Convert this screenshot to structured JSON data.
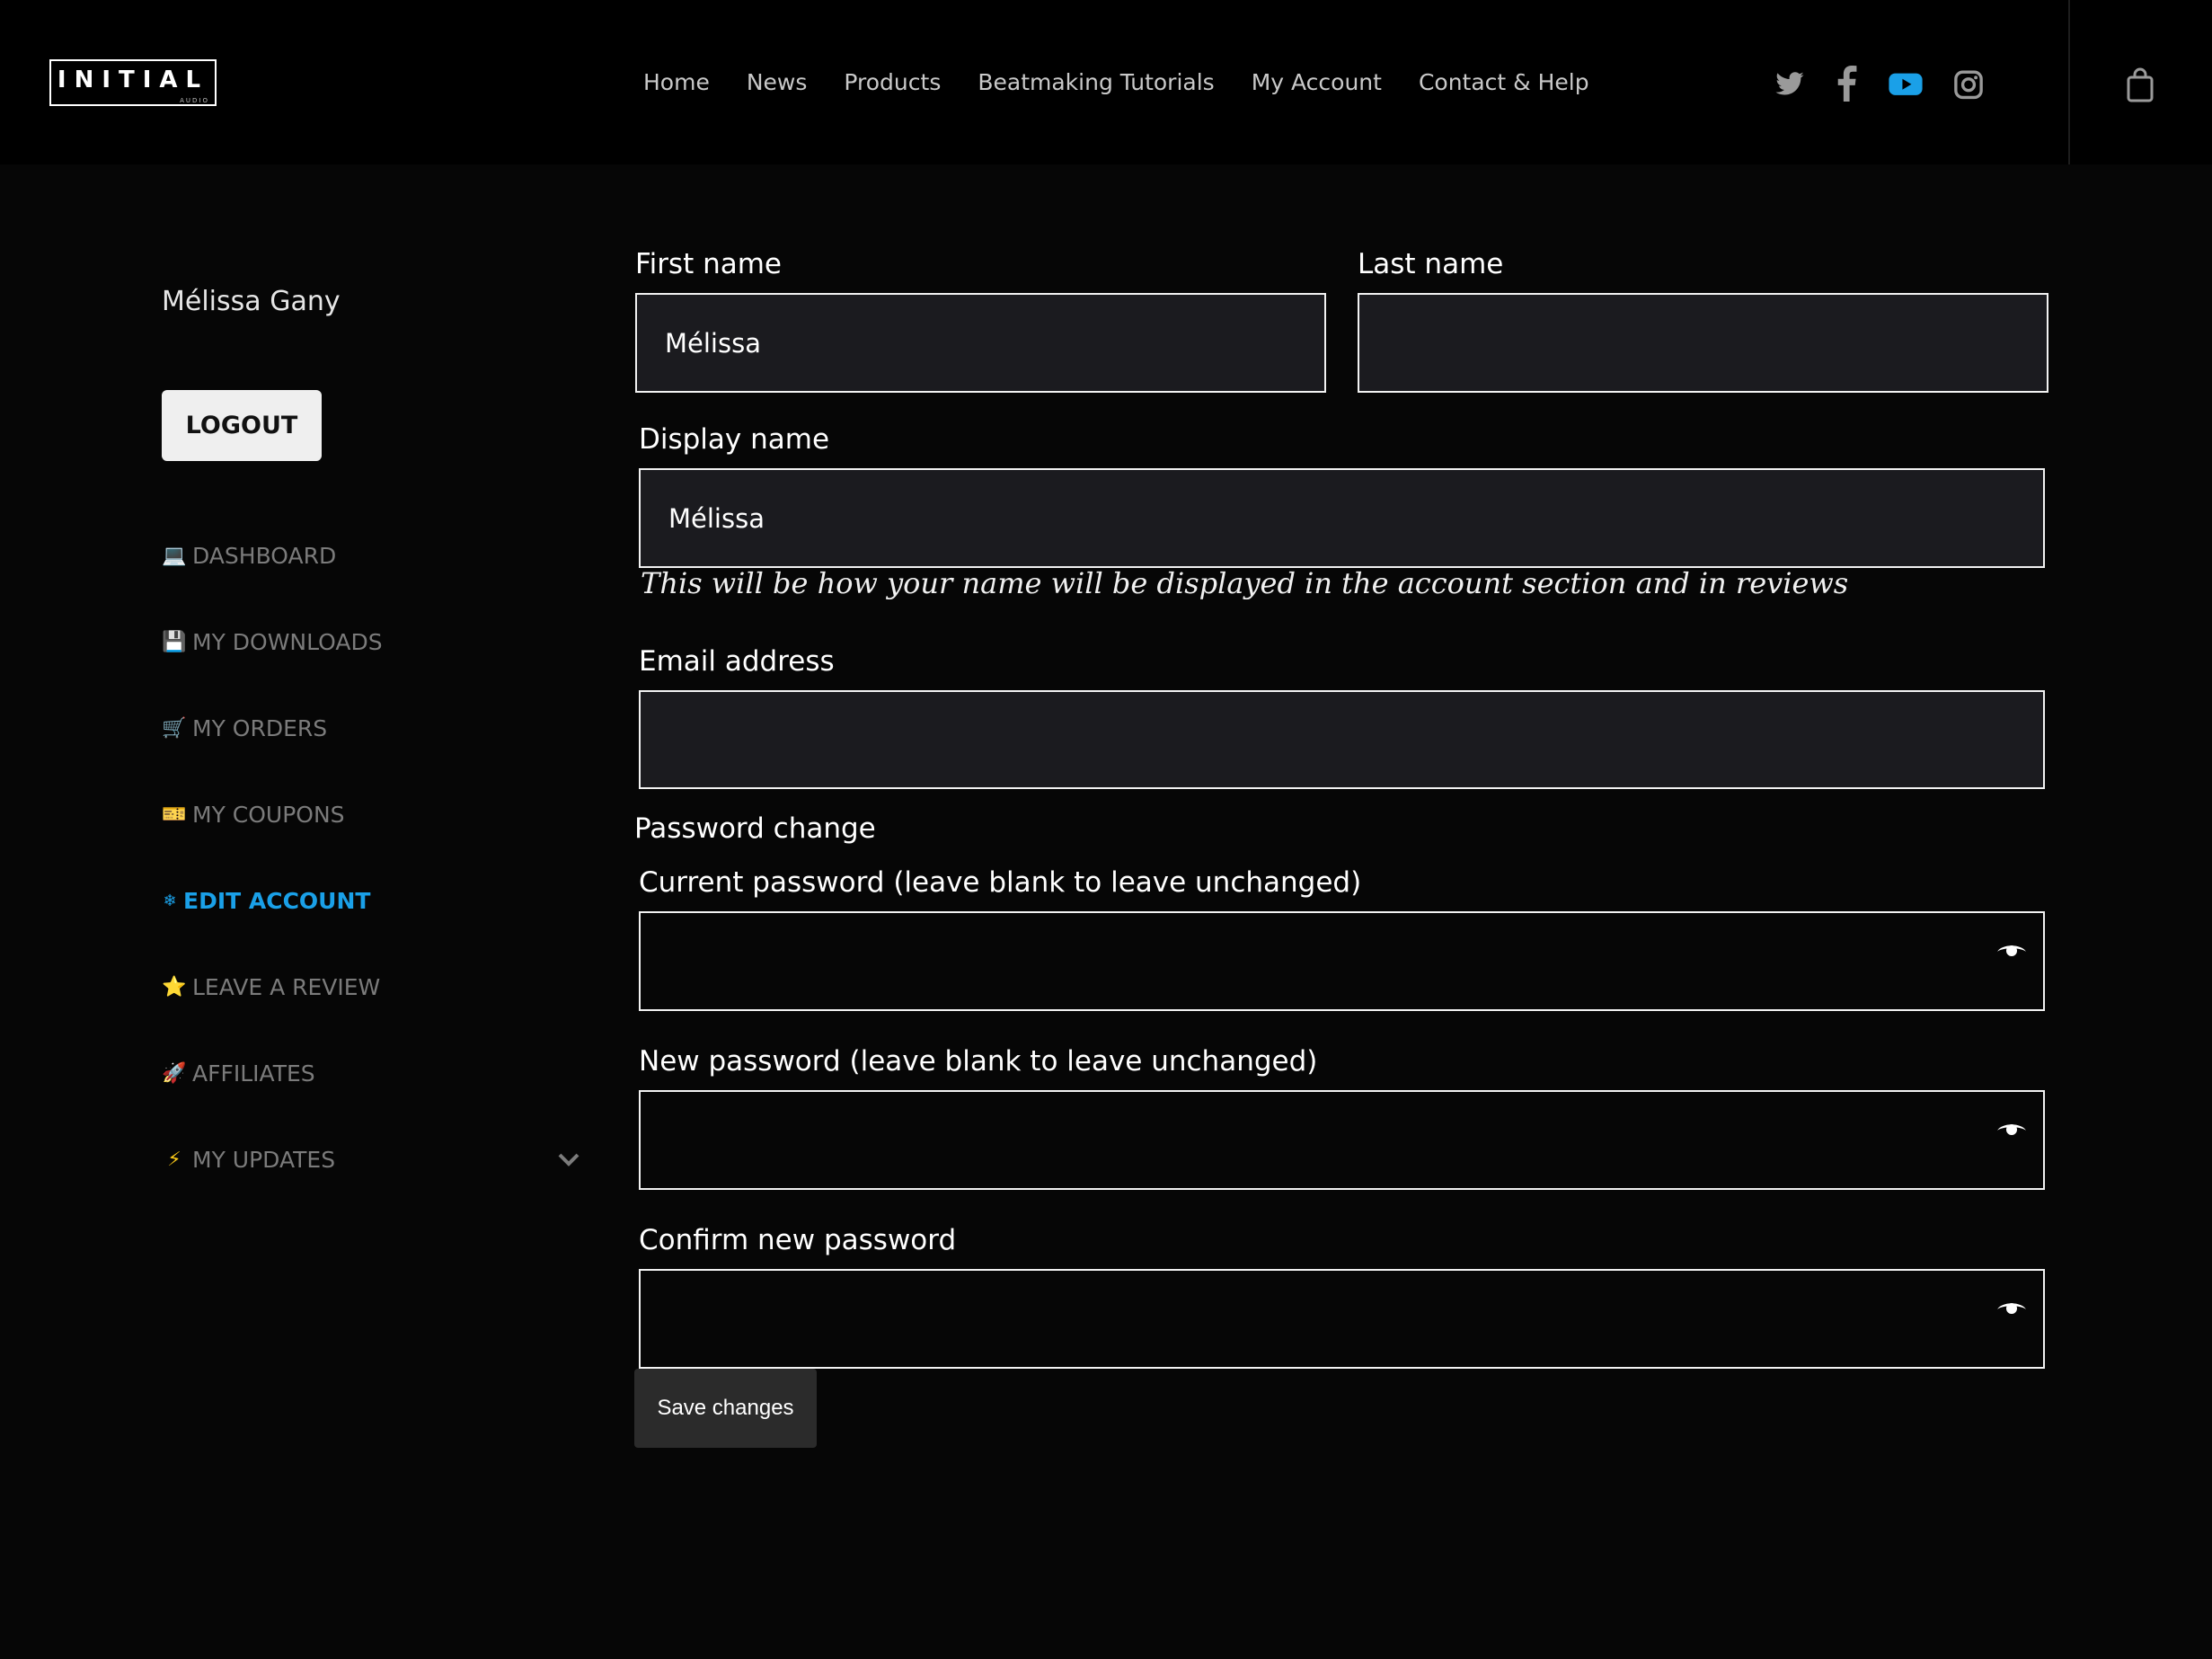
{
  "header": {
    "logo_text": "INITIAL",
    "logo_sub": "AUDIO",
    "nav": [
      "Home",
      "News",
      "Products",
      "Beatmaking Tutorials",
      "My Account",
      "Contact & Help"
    ],
    "social_icons": [
      "twitter-icon",
      "facebook-icon",
      "youtube-icon",
      "instagram-icon"
    ],
    "youtube_color": "#1aa0e8"
  },
  "sidebar": {
    "user_name": "Mélissa Gany",
    "logout_label": "LOGOUT",
    "items": [
      {
        "emoji": "💻",
        "label": "DASHBOARD"
      },
      {
        "emoji": "💾",
        "label": "MY DOWNLOADS"
      },
      {
        "emoji": "🛒",
        "label": "MY ORDERS"
      },
      {
        "emoji": "🎫",
        "label": "MY COUPONS"
      },
      {
        "emoji": "❄",
        "label": "EDIT ACCOUNT"
      },
      {
        "emoji": "⭐",
        "label": "LEAVE A REVIEW"
      },
      {
        "emoji": "🚀",
        "label": "AFFILIATES"
      },
      {
        "emoji": "⚡",
        "label": "MY UPDATES"
      }
    ],
    "active_index": 4,
    "accent": "#1aa0e8"
  },
  "form": {
    "first_name": {
      "label": "First name",
      "value": "Mélissa"
    },
    "last_name": {
      "label": "Last name",
      "value": ""
    },
    "display_name": {
      "label": "Display name",
      "value": "Mélissa",
      "hint": "This will be how your name will be displayed in the account section and in reviews"
    },
    "email": {
      "label": "Email address",
      "value": ""
    },
    "password_section_title": "Password change",
    "current_password": {
      "label": "Current password (leave blank to leave unchanged)",
      "value": ""
    },
    "new_password": {
      "label": "New password (leave blank to leave unchanged)",
      "value": ""
    },
    "confirm_password": {
      "label": "Confirm new password",
      "value": ""
    },
    "save_label": "Save changes"
  }
}
